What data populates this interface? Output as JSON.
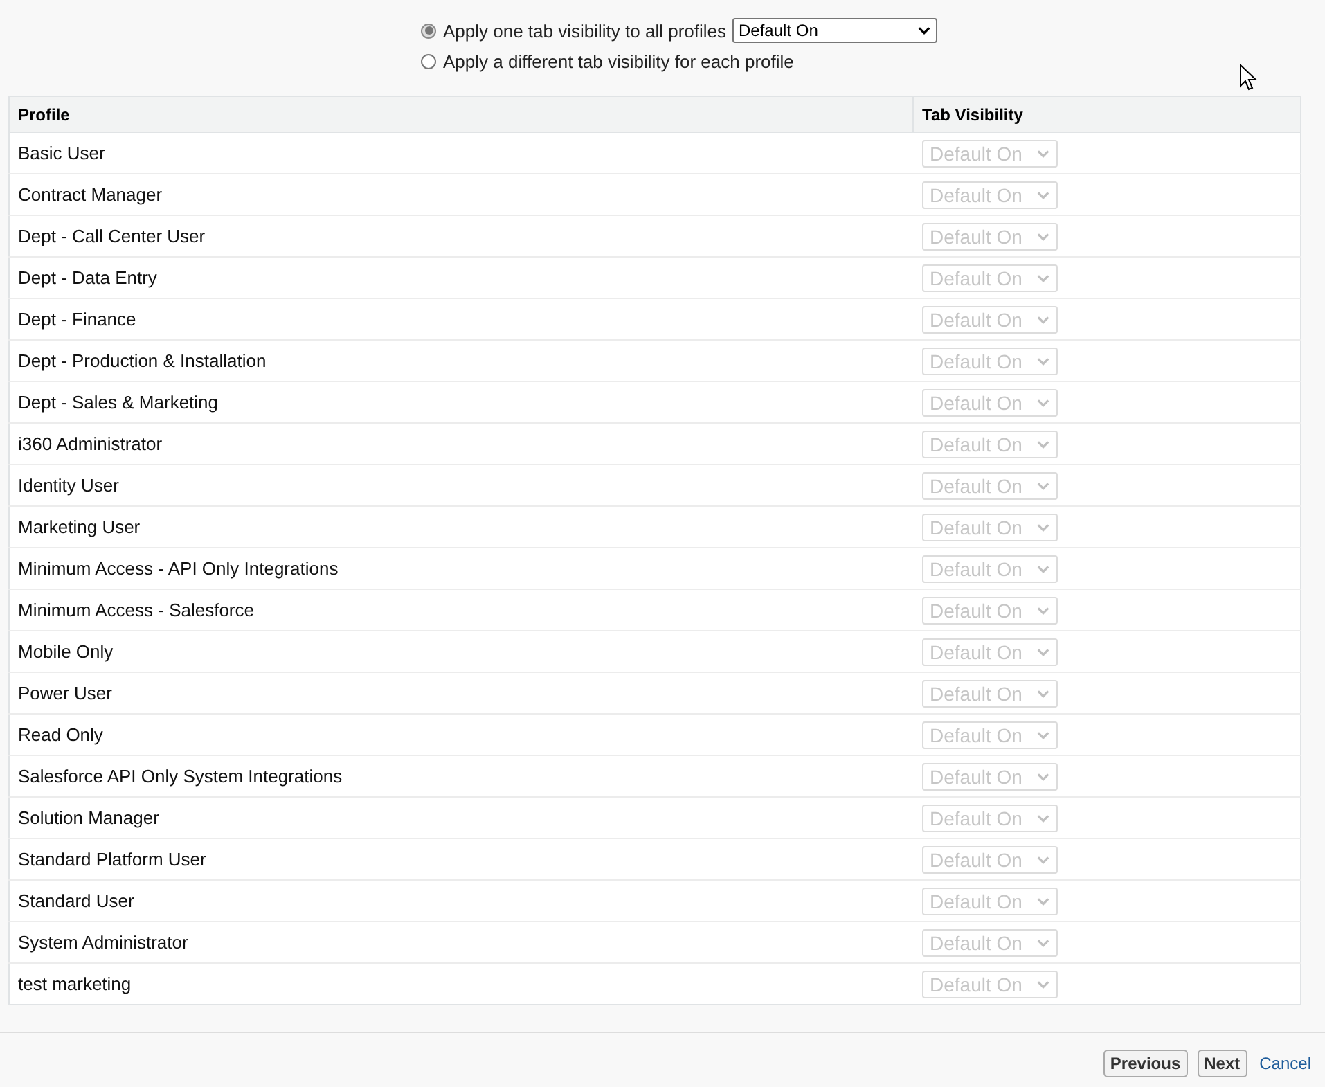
{
  "visibility_options": [
    {
      "label": "Apply one tab visibility to all profiles",
      "selected": true,
      "dropdown": "Default On"
    },
    {
      "label": "Apply a different tab visibility for each profile",
      "selected": false
    }
  ],
  "table": {
    "columns": [
      "Profile",
      "Tab Visibility"
    ],
    "rows": [
      {
        "profile": "Basic User",
        "visibility": "Default On",
        "disabled": true
      },
      {
        "profile": "Contract Manager",
        "visibility": "Default On",
        "disabled": true
      },
      {
        "profile": "Dept - Call Center User",
        "visibility": "Default On",
        "disabled": true
      },
      {
        "profile": "Dept - Data Entry",
        "visibility": "Default On",
        "disabled": true
      },
      {
        "profile": "Dept - Finance",
        "visibility": "Default On",
        "disabled": true
      },
      {
        "profile": "Dept - Production & Installation",
        "visibility": "Default On",
        "disabled": true
      },
      {
        "profile": "Dept - Sales & Marketing",
        "visibility": "Default On",
        "disabled": true
      },
      {
        "profile": "i360 Administrator",
        "visibility": "Default On",
        "disabled": true
      },
      {
        "profile": "Identity User",
        "visibility": "Default On",
        "disabled": true
      },
      {
        "profile": "Marketing User",
        "visibility": "Default On",
        "disabled": true
      },
      {
        "profile": "Minimum Access - API Only Integrations",
        "visibility": "Default On",
        "disabled": true
      },
      {
        "profile": "Minimum Access - Salesforce",
        "visibility": "Default On",
        "disabled": true
      },
      {
        "profile": "Mobile Only",
        "visibility": "Default On",
        "disabled": true
      },
      {
        "profile": "Power User",
        "visibility": "Default On",
        "disabled": true
      },
      {
        "profile": "Read Only",
        "visibility": "Default On",
        "disabled": true
      },
      {
        "profile": "Salesforce API Only System Integrations",
        "visibility": "Default On",
        "disabled": true
      },
      {
        "profile": "Solution Manager",
        "visibility": "Default On",
        "disabled": true
      },
      {
        "profile": "Standard Platform User",
        "visibility": "Default On",
        "disabled": true
      },
      {
        "profile": "Standard User",
        "visibility": "Default On",
        "disabled": true
      },
      {
        "profile": "System Administrator",
        "visibility": "Default On",
        "disabled": true
      },
      {
        "profile": "test marketing",
        "visibility": "Default On",
        "disabled": true
      }
    ]
  },
  "buttons": [
    {
      "label": "Previous",
      "kind": "button"
    },
    {
      "label": "Next",
      "kind": "button"
    },
    {
      "label": "Cancel",
      "kind": "link"
    }
  ]
}
